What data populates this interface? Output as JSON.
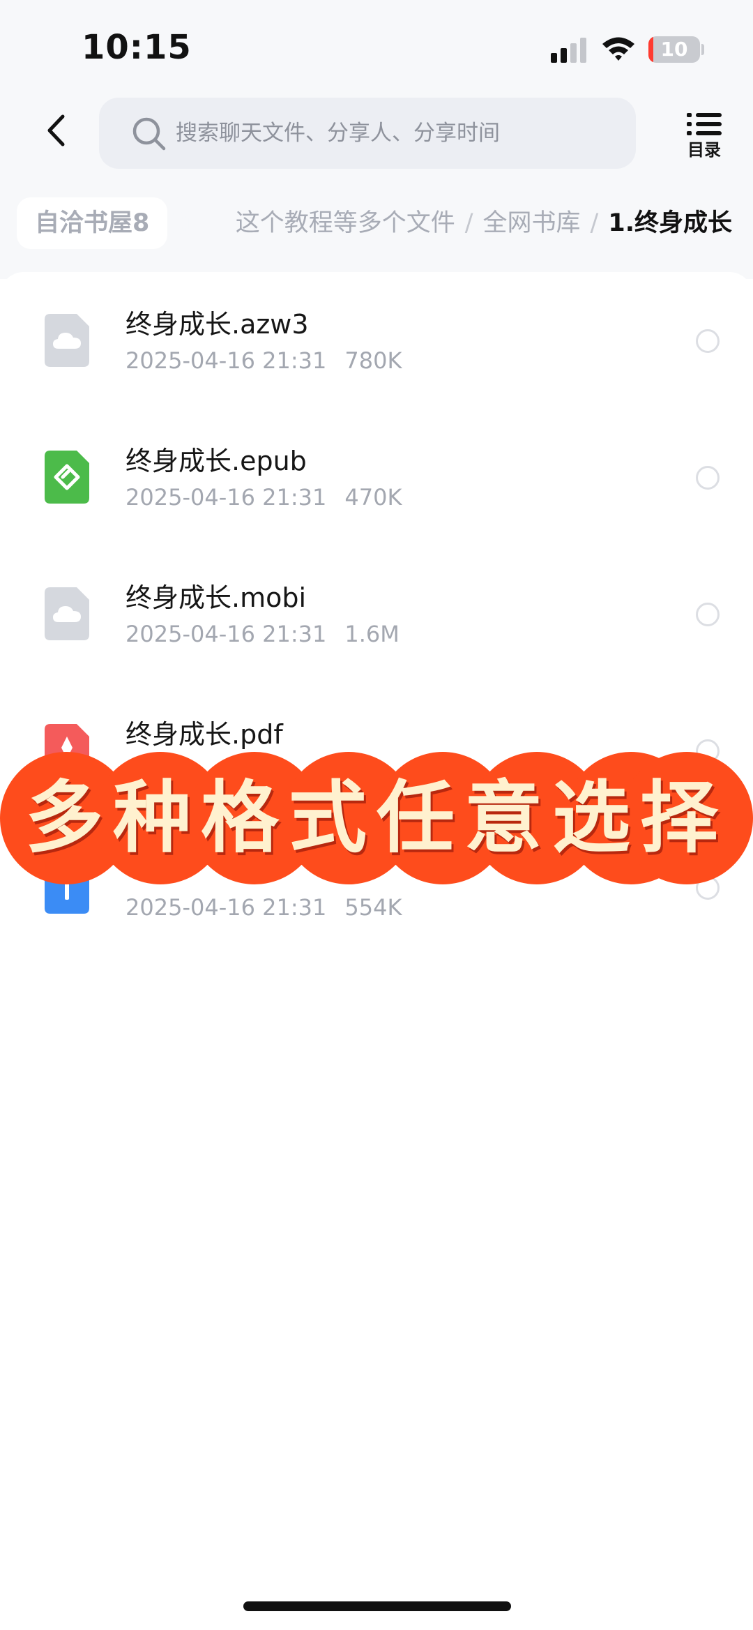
{
  "status_bar": {
    "time": "10:15",
    "battery_level": "10"
  },
  "nav": {
    "back_icon": "chevron-left-icon",
    "search_placeholder": "搜索聊天文件、分享人、分享时间",
    "toc_label": "目录"
  },
  "breadcrumb": {
    "root": "自洽书屋8",
    "items": [
      "这个教程等多个文件",
      "全网书库",
      "1.终身成长"
    ],
    "separator": "/"
  },
  "files": [
    {
      "name": "终身成长.azw3",
      "date": "2025-04-16 21:31",
      "size": "780K",
      "icon": "cloud-file-icon",
      "color": "#d5d8de"
    },
    {
      "name": "终身成长.epub",
      "date": "2025-04-16 21:31",
      "size": "470K",
      "icon": "epub-file-icon",
      "color": "#4cbb4a"
    },
    {
      "name": "终身成长.mobi",
      "date": "2025-04-16 21:31",
      "size": "1.6M",
      "icon": "cloud-file-icon",
      "color": "#d5d8de"
    },
    {
      "name": "终身成长.pdf",
      "date": "",
      "size": "",
      "icon": "pdf-file-icon",
      "color": "#f45b5b"
    },
    {
      "name": "",
      "date": "2025-04-16 21:31",
      "size": "554K",
      "icon": "zip-file-icon",
      "color": "#3b8cf5"
    }
  ],
  "overlay": {
    "text": "多种格式任意选择",
    "color": "#fe4c1c",
    "text_color": "#fff1cf"
  }
}
